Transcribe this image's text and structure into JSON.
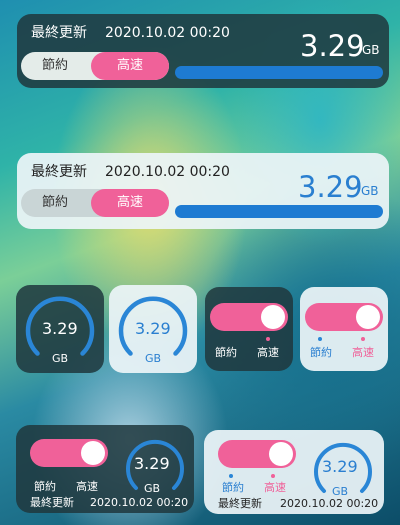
{
  "widget_large_dark": {
    "title": "最終更新",
    "timestamp": "2020.10.02 00:20",
    "value": "3.29",
    "unit": "GB",
    "option_save": "節約",
    "option_fast": "高速",
    "usage_level": 1.0
  },
  "widget_large_light": {
    "title": "最終更新",
    "timestamp": "2020.10.02 00:20",
    "value": "3.29",
    "unit": "GB",
    "option_save": "節約",
    "option_fast": "高速",
    "usage_level": 1.0
  },
  "gauge_dark": {
    "value": "3.29",
    "unit": "GB"
  },
  "gauge_light": {
    "value": "3.29",
    "unit": "GB"
  },
  "toggle_dark": {
    "label_save": "節約",
    "label_fast": "高速"
  },
  "toggle_light": {
    "label_save": "節約",
    "label_fast": "高速"
  },
  "widget_combo_dark": {
    "value": "3.29",
    "unit": "GB",
    "label_save": "節約",
    "label_fast": "高速",
    "title": "最終更新",
    "timestamp": "2020.10.02 00:20"
  },
  "widget_combo_light": {
    "value": "3.29",
    "unit": "GB",
    "label_save": "節約",
    "label_fast": "高速",
    "title": "最終更新",
    "timestamp": "2020.10.02 00:20"
  },
  "colors": {
    "accent_pink": "#f06199",
    "bar_blue": "#1e7bd2",
    "gauge_blue": "#2a86d6"
  }
}
